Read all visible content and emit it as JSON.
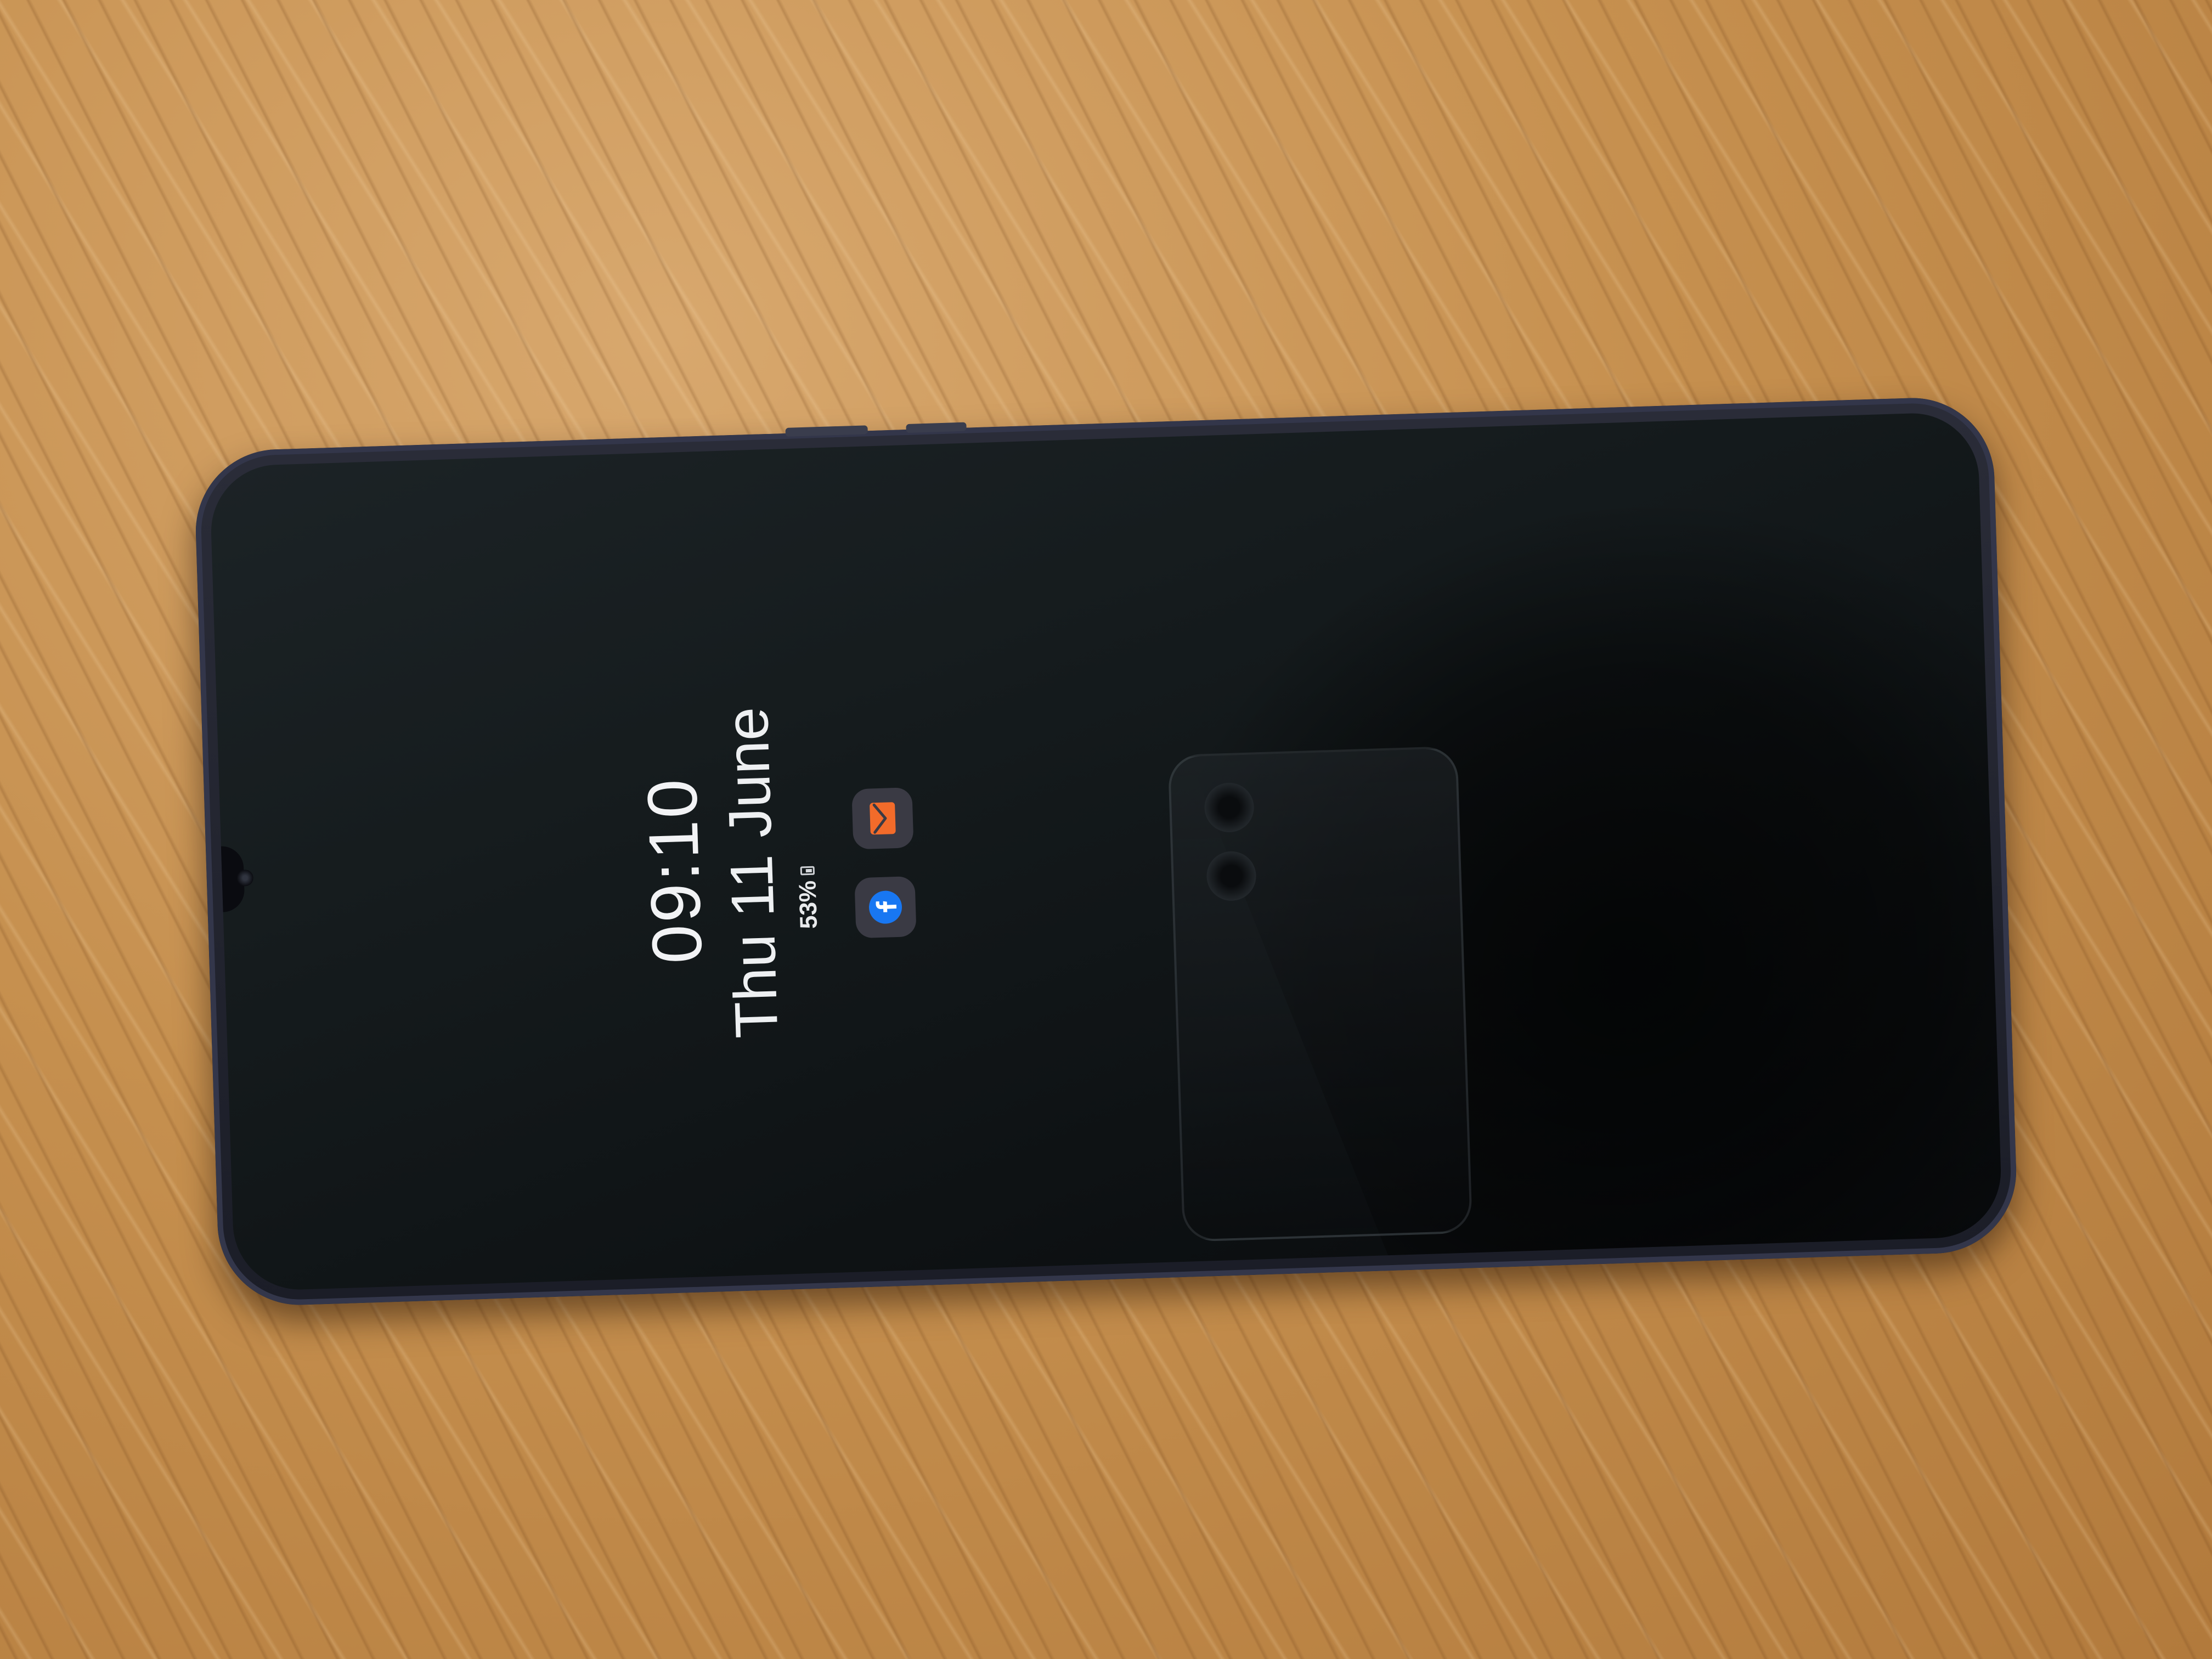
{
  "lock_screen": {
    "time": "09:10",
    "date": "Thu 11 June",
    "battery_level": "53%"
  },
  "notification_icons": [
    {
      "icon": "facebook-icon",
      "color": "#1877f2"
    },
    {
      "icon": "mail-icon",
      "color": "#f26b2a"
    }
  ],
  "colors": {
    "table_wood": "#c6904f",
    "phone_body": "#1b1d27",
    "screen": "#151b1d",
    "aod_text": "#f2f3f5"
  }
}
